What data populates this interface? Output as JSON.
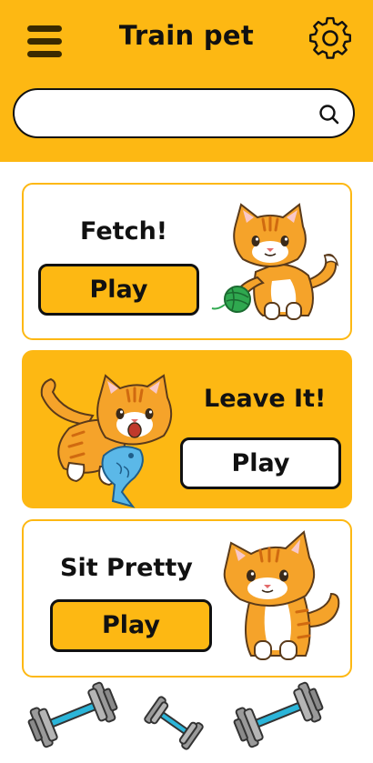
{
  "header": {
    "title": "Train pet",
    "menu_icon": "hamburger-menu-icon",
    "settings_icon": "gear-icon"
  },
  "search": {
    "value": "",
    "placeholder": "",
    "icon": "search-icon"
  },
  "colors": {
    "accent": "#FDB813",
    "text": "#111111",
    "background": "#FFFFFF"
  },
  "cards": [
    {
      "title": "Fetch!",
      "play_label": "Play",
      "illustration": "cat-with-yarn-ball"
    },
    {
      "title": "Leave It!",
      "play_label": "Play",
      "illustration": "cat-with-fish"
    },
    {
      "title": "Sit Pretty",
      "play_label": "Play",
      "illustration": "sitting-cat"
    }
  ],
  "bottom_icons": [
    "dumbbell-icon",
    "dumbbell-icon",
    "dumbbell-icon"
  ]
}
